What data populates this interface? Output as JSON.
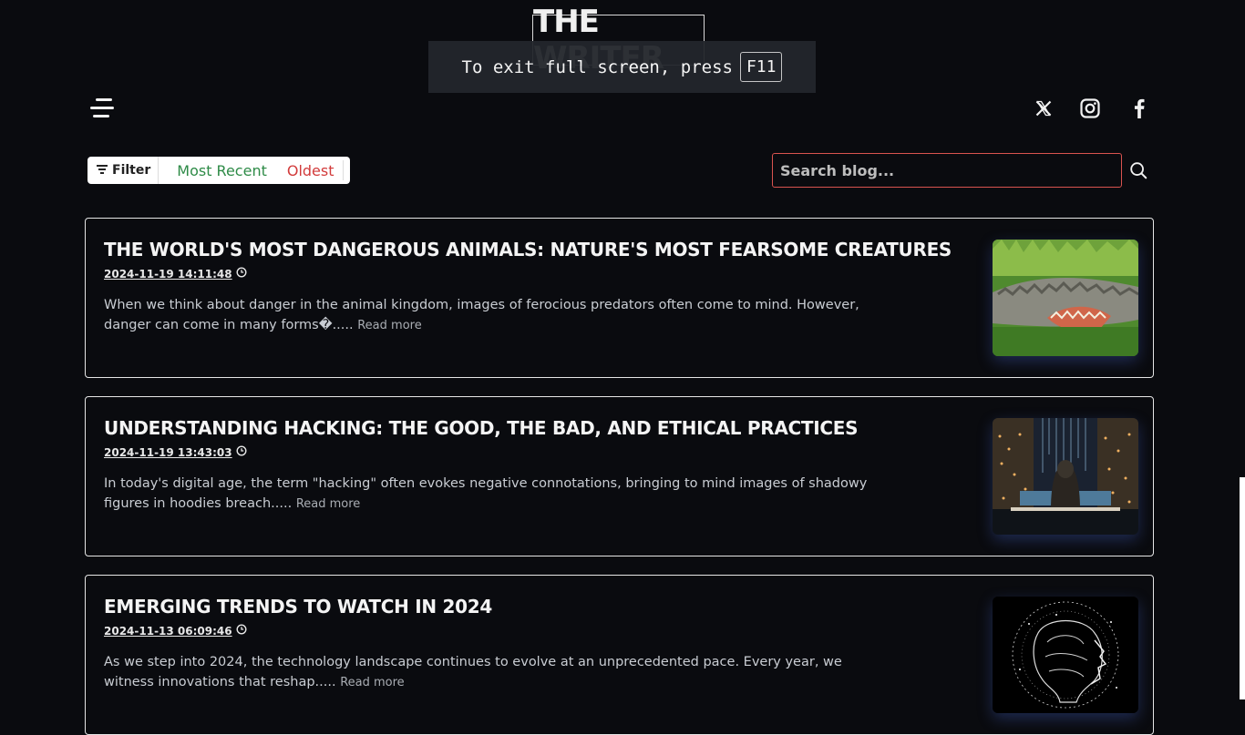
{
  "site": {
    "logo_text": "THE WRITER"
  },
  "fullscreen_notice": {
    "text": "To exit full screen, press",
    "key": "F11"
  },
  "header": {
    "menu_icon": "hamburger-menu-icon",
    "social_icons": [
      "x-twitter-icon",
      "instagram-icon",
      "facebook-icon"
    ]
  },
  "filter": {
    "label": "Filter",
    "options": [
      "Most Recent",
      "Oldest"
    ],
    "colors": {
      "recent": "#2e8b47",
      "oldest": "#d23b3b"
    }
  },
  "search": {
    "placeholder": "Search blog...",
    "value": "",
    "border_color": "#d9534f"
  },
  "posts": [
    {
      "title": "The World's Most Dangerous Animals: Nature's Most Fearsome Creatures",
      "date": "2024-11-19 14:11:48",
      "excerpt": "When we think about danger in the animal kingdom, images of ferocious predators often come to mind. However, danger can come in many forms�.....",
      "read_more": "Read more",
      "image": "crocodile-thumbnail"
    },
    {
      "title": "Understanding Hacking: The Good, the Bad, and Ethical Practices",
      "date": "2024-11-19 13:43:03",
      "excerpt": "In today's digital age, the term \"hacking\" often evokes negative connotations, bringing to mind images of shadowy figures in hoodies breach.....",
      "read_more": "Read more",
      "image": "hooded-hacker-thumbnail"
    },
    {
      "title": "Emerging Trends to Watch in 2024",
      "date": "2024-11-13 06:09:46",
      "excerpt": "As we step into 2024, the technology landscape continues to evolve at an unprecedented pace. Every year, we witness innovations that reshap.....",
      "read_more": "Read more",
      "image": "ai-brain-thumbnail"
    }
  ]
}
